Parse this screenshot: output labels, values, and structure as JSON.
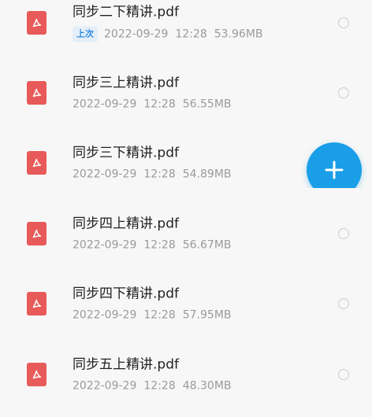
{
  "files": [
    {
      "name": "同步二下精讲.pdf",
      "badge": "上次",
      "date": "2022-09-29",
      "time": "12:28",
      "size": "53.96MB"
    },
    {
      "name": "同步三上精讲.pdf",
      "date": "2022-09-29",
      "time": "12:28",
      "size": "56.55MB"
    },
    {
      "name": "同步三下精讲.pdf",
      "date": "2022-09-29",
      "time": "12:28",
      "size": "54.89MB"
    },
    {
      "name": "同步四上精讲.pdf",
      "date": "2022-09-29",
      "time": "12:28",
      "size": "56.67MB"
    },
    {
      "name": "同步四下精讲.pdf",
      "date": "2022-09-29",
      "time": "12:28",
      "size": "57.95MB"
    },
    {
      "name": "同步五上精讲.pdf",
      "date": "2022-09-29",
      "time": "12:28",
      "size": "48.30MB"
    }
  ],
  "fab": {
    "icon": "plus-icon"
  },
  "icons": {
    "file": "pdf-icon",
    "select": "radio-circle-icon"
  },
  "colors": {
    "pdf_icon": "#e85a5a",
    "fab": "#1a9ee8",
    "badge_text": "#2e8ddf"
  }
}
